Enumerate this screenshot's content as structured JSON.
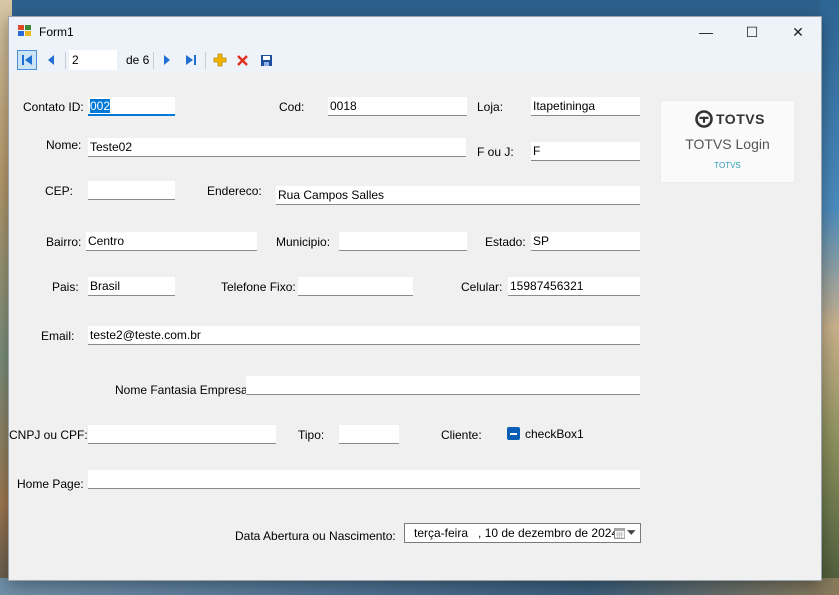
{
  "window": {
    "title": "Form1",
    "minimize": "—",
    "maximize": "☐",
    "close": "✕"
  },
  "toolbar": {
    "position": "2",
    "count_label": "de 6",
    "icons": [
      "first-icon",
      "prev-icon",
      "next-icon",
      "last-icon",
      "add-icon",
      "delete-icon",
      "save-icon"
    ],
    "colors": {
      "nav": "#1e6fd0",
      "add": "#f0b400",
      "delete": "#e0301e",
      "save": "#1e4f9c"
    }
  },
  "form": {
    "contato_id": {
      "label": "Contato ID:",
      "value": "002"
    },
    "cod": {
      "label": "Cod:",
      "value": "0018"
    },
    "loja": {
      "label": "Loja:",
      "value": "Itapetininga"
    },
    "nome": {
      "label": "Nome:",
      "value": "Teste02"
    },
    "f_ou_j": {
      "label": "F ou J:",
      "value": "F"
    },
    "cep": {
      "label": "CEP:",
      "value": ""
    },
    "endereco": {
      "label": "Endereco:",
      "value": "Rua Campos Salles"
    },
    "bairro": {
      "label": "Bairro:",
      "value": "Centro"
    },
    "municipio": {
      "label": "Municipio:",
      "value": ""
    },
    "estado": {
      "label": "Estado:",
      "value": "SP"
    },
    "pais": {
      "label": "Pais:",
      "value": "Brasil"
    },
    "telefone": {
      "label": "Telefone Fixo:",
      "value": ""
    },
    "celular": {
      "label": "Celular:",
      "value": "15987456321"
    },
    "email": {
      "label": "Email:",
      "value": "teste2@teste.com.br"
    },
    "nome_fantasia": {
      "label": "Nome Fantasia Empresa:",
      "value": ""
    },
    "cnpj": {
      "label": "CNPJ ou CPF:",
      "value": ""
    },
    "tipo": {
      "label": "Tipo:",
      "value": ""
    },
    "cliente": {
      "label": "Cliente:",
      "checkbox_label": "checkBox1",
      "state": "indeterminate"
    },
    "home_page": {
      "label": "Home Page:",
      "value": ""
    },
    "data_abertura": {
      "label": "Data Abertura ou Nascimento:",
      "value": "terça-feira   , 10 de dezembro de 2024"
    }
  },
  "totvs": {
    "logo": "TOTVS",
    "title": "TOTVS Login",
    "subtitle": "TOTVS",
    "accent": "#2a9bb5"
  }
}
